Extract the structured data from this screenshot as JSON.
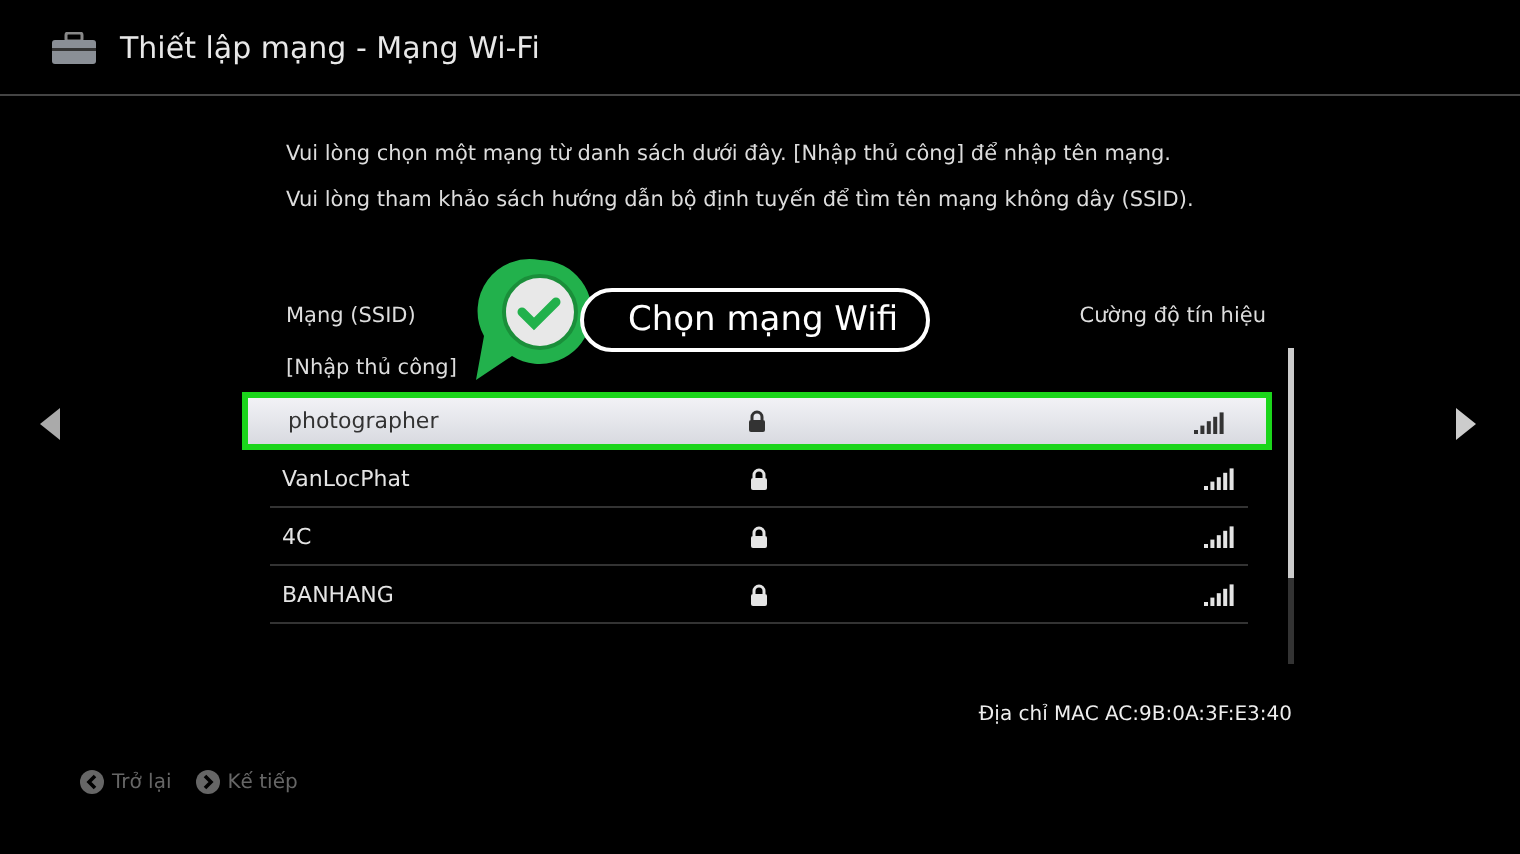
{
  "header": {
    "title": "Thiết lập mạng - Mạng Wi-Fi"
  },
  "instructions": [
    "Vui lòng chọn một mạng từ danh sách dưới đây. [Nhập thủ công] để nhập tên mạng.",
    "Vui lòng tham khảo sách hướng dẫn bộ định tuyến để tìm tên mạng không dây (SSID)."
  ],
  "columns": [
    "Mạng (SSID)",
    "Cường độ tín hiệu"
  ],
  "manual_entry": "[Nhập thủ công]",
  "networks": [
    {
      "name": "photographer",
      "locked": true,
      "selected": true
    },
    {
      "name": "VanLocPhat",
      "locked": true,
      "selected": false
    },
    {
      "name": "4C",
      "locked": true,
      "selected": false
    },
    {
      "name": "BANHANG",
      "locked": true,
      "selected": false
    }
  ],
  "callout": "Chọn mạng Wifi",
  "mac": "Địa chỉ MAC AC:9B:0A:3F:E3:40",
  "footer": [
    {
      "label": "Trở lại",
      "kind": "back",
      "disabled": true
    },
    {
      "label": "Kế tiếp",
      "kind": "next",
      "disabled": true
    }
  ]
}
